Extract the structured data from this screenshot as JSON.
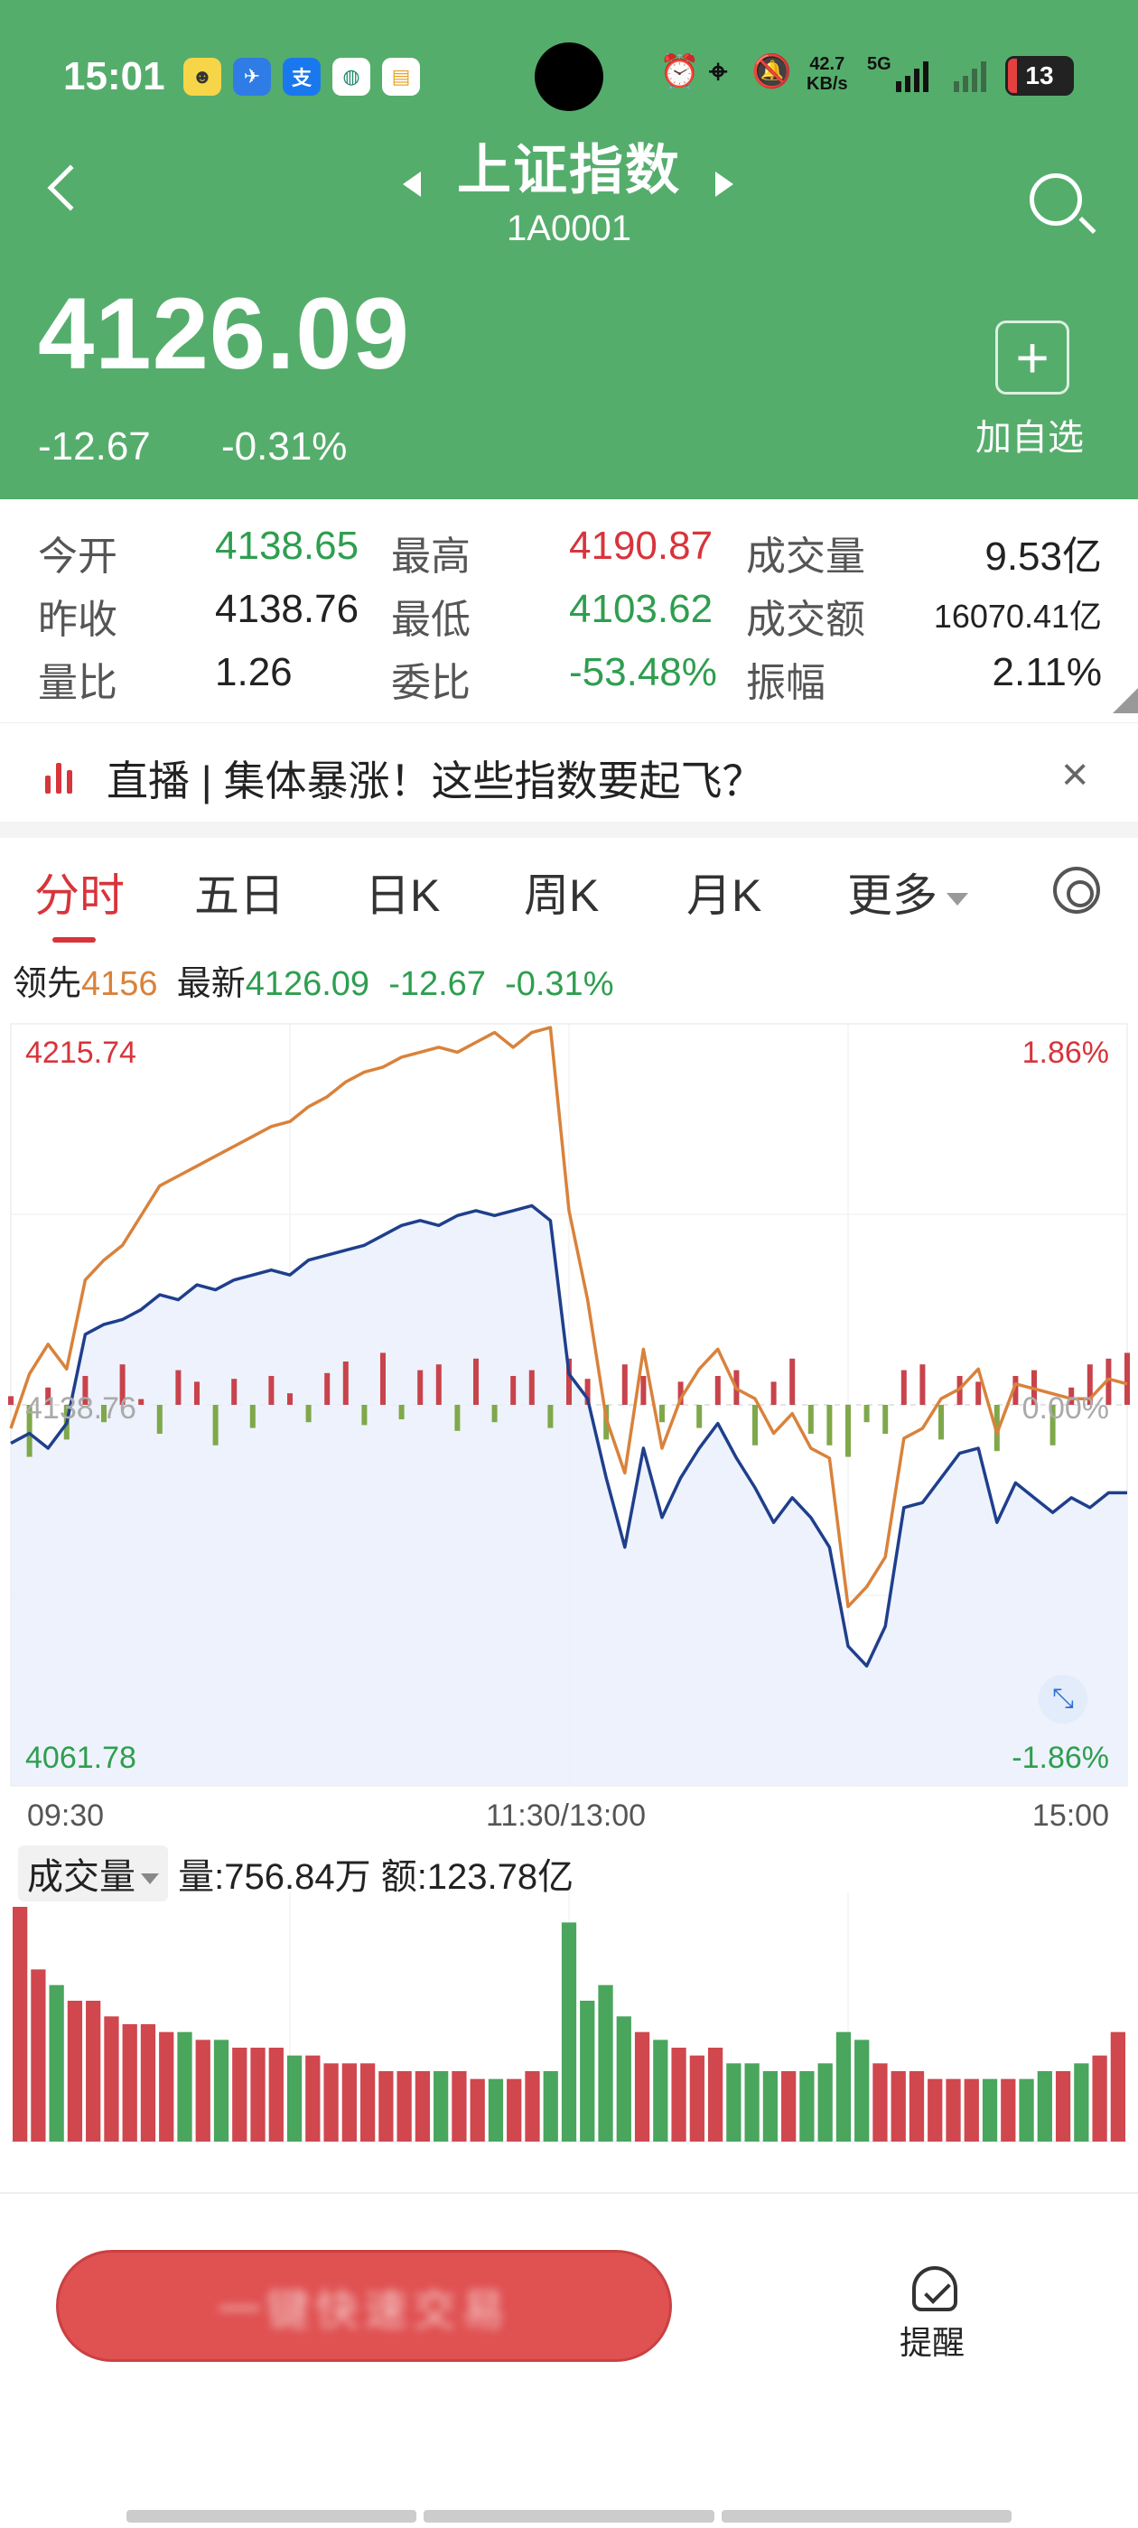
{
  "status_bar": {
    "time": "15:01",
    "net_speed": "42.7",
    "net_unit": "KB/s",
    "network": "5G",
    "battery": "13",
    "app_icons": [
      "weibo-icon",
      "xiaoyi-icon",
      "alipay-icon",
      "bank-icon",
      "wallet-icon"
    ]
  },
  "header": {
    "title": "上证指数",
    "code": "1A0001",
    "price": "4126.09",
    "change": "-12.67",
    "change_pct": "-0.31%",
    "add_label": "加自选",
    "bg_color": "#55ad6c"
  },
  "stats": [
    {
      "label": "今开",
      "value": "4138.65",
      "tone": "green"
    },
    {
      "label": "最高",
      "value": "4190.87",
      "tone": "red"
    },
    {
      "label": "成交量",
      "value": "9.53亿",
      "tone": "plain"
    },
    {
      "label": "昨收",
      "value": "4138.76",
      "tone": "plain"
    },
    {
      "label": "最低",
      "value": "4103.62",
      "tone": "green"
    },
    {
      "label": "成交额",
      "value": "16070.41亿",
      "tone": "plain"
    },
    {
      "label": "量比",
      "value": "1.26",
      "tone": "plain"
    },
    {
      "label": "委比",
      "value": "-53.48%",
      "tone": "green"
    },
    {
      "label": "振幅",
      "value": "2.11%",
      "tone": "plain"
    }
  ],
  "live": {
    "text": "直播 | 集体暴涨！这些指数要起飞？"
  },
  "tabs": [
    "分时",
    "五日",
    "日K",
    "周K",
    "月K",
    "更多"
  ],
  "quote_line": {
    "lead_label": "领先",
    "lead_value": "4156",
    "latest_label": "最新",
    "latest_value": "4126.09",
    "change": "-12.67",
    "pct": "-0.31%"
  },
  "chart_axis": {
    "y_top": "4215.74",
    "y_mid": "4138.76",
    "y_bottom": "4061.78",
    "pct_top": "1.86%",
    "pct_mid": "0.00%",
    "pct_bottom": "-1.86%",
    "x_start": "09:30",
    "x_mid": "11:30/13:00",
    "x_end": "15:00"
  },
  "volume_bar": {
    "tag": "成交量",
    "info": "量:756.84万 额:123.78亿"
  },
  "bottom": {
    "trade_label": "一键快速交易",
    "alarm_label": "提醒"
  },
  "chart_data": {
    "type": "line",
    "title": "",
    "x_ticks": [
      "09:30",
      "11:30/13:00",
      "15:00"
    ],
    "ylim": [
      4061.78,
      4215.74
    ],
    "pct_lim": [
      -1.86,
      1.86
    ],
    "base": 4138.76,
    "x": [
      0,
      4,
      8,
      12,
      16,
      20,
      24,
      28,
      32,
      36,
      40,
      44,
      48,
      52,
      56,
      60,
      64,
      68,
      72,
      76,
      80,
      84,
      88,
      92,
      96,
      100,
      104,
      108,
      112,
      116,
      120,
      124,
      128,
      132,
      136,
      140,
      144,
      148,
      152,
      156,
      160,
      164,
      168,
      172,
      176,
      180,
      184,
      188,
      192,
      196,
      200,
      204,
      208,
      212,
      216,
      220,
      224,
      228,
      232,
      236,
      240
    ],
    "series": [
      {
        "name": "最新",
        "color": "#1f3f8c",
        "values": [
          4131,
          4133,
          4130,
          4135,
          4153,
          4155,
          4156,
          4158,
          4161,
          4160,
          4163,
          4162,
          4164,
          4165,
          4166,
          4165,
          4168,
          4169,
          4170,
          4171,
          4173,
          4175,
          4176,
          4175,
          4177,
          4178,
          4177,
          4178,
          4179,
          4176,
          4145,
          4140,
          4124,
          4110,
          4130,
          4116,
          4124,
          4130,
          4135,
          4128,
          4122,
          4115,
          4120,
          4116,
          4110,
          4090,
          4086,
          4094,
          4118,
          4119,
          4124,
          4129,
          4130,
          4115,
          4123,
          4120,
          4117,
          4120,
          4118,
          4121,
          4121
        ]
      },
      {
        "name": "领先",
        "color": "#d9823b",
        "values": [
          4134,
          4145,
          4151,
          4146,
          4164,
          4168,
          4171,
          4177,
          4183,
          4185,
          4187,
          4189,
          4191,
          4193,
          4195,
          4196,
          4199,
          4201,
          4204,
          4206,
          4207,
          4209,
          4210,
          4211,
          4210,
          4212,
          4214,
          4211,
          4214,
          4215,
          4178,
          4160,
          4136,
          4125,
          4150,
          4130,
          4140,
          4146,
          4150,
          4142,
          4140,
          4133,
          4137,
          4130,
          4128,
          4098,
          4102,
          4108,
          4132,
          4134,
          4140,
          4142,
          4146,
          4133,
          4143,
          4142,
          4141,
          4140,
          4140,
          4144,
          4143
        ]
      }
    ],
    "net_flow": [
      3,
      -18,
      6,
      -12,
      10,
      -6,
      14,
      2,
      -10,
      12,
      8,
      -14,
      9,
      -8,
      10,
      4,
      -6,
      11,
      15,
      -7,
      18,
      -5,
      12,
      14,
      -9,
      16,
      -6,
      10,
      12,
      -8,
      16,
      9,
      -12,
      14,
      10,
      -6,
      8,
      -8,
      10,
      12,
      -14,
      8,
      16,
      -10,
      -14,
      -18,
      -6,
      -10,
      12,
      14,
      -12,
      10,
      8,
      -16,
      10,
      12,
      -14,
      6,
      14,
      16,
      18
    ],
    "volume": [
      30,
      22,
      20,
      18,
      18,
      16,
      15,
      15,
      14,
      14,
      13,
      13,
      12,
      12,
      12,
      11,
      11,
      10,
      10,
      10,
      9,
      9,
      9,
      9,
      9,
      8,
      8,
      8,
      9,
      9,
      28,
      18,
      20,
      16,
      14,
      13,
      12,
      11,
      12,
      10,
      10,
      9,
      9,
      9,
      10,
      14,
      13,
      10,
      9,
      9,
      8,
      8,
      8,
      8,
      8,
      8,
      9,
      9,
      10,
      11,
      14
    ]
  }
}
